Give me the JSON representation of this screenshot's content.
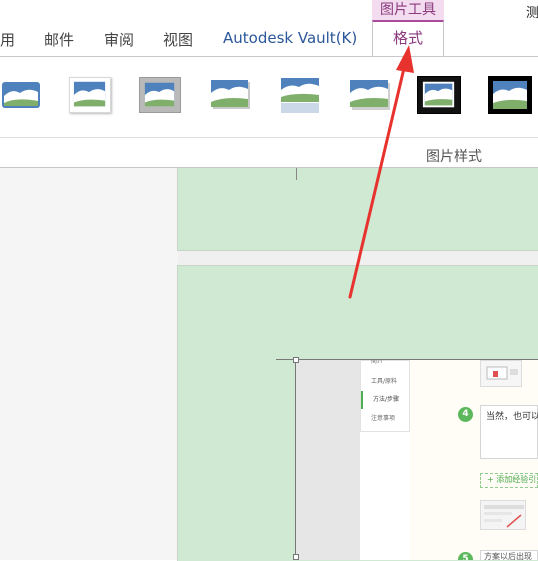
{
  "ribbon": {
    "tabs": [
      {
        "label": "用"
      },
      {
        "label": "邮件"
      },
      {
        "label": "审阅"
      },
      {
        "label": "视图"
      },
      {
        "label": "Autodesk Vault(K)"
      }
    ],
    "context_header": "图片工具",
    "active_tab": "格式",
    "corner_text": "测",
    "gallery_group_label": "图片样式",
    "picture_styles": [
      {
        "name": "soft-edge-style"
      },
      {
        "name": "white-frame-shadow-style"
      },
      {
        "name": "gray-bevel-frame-style"
      },
      {
        "name": "drop-shadow-style"
      },
      {
        "name": "reflection-style"
      },
      {
        "name": "perspective-shadow-style"
      },
      {
        "name": "black-thick-frame-style"
      },
      {
        "name": "black-frame-style"
      }
    ]
  },
  "document": {
    "picture": {
      "menu_items": [
        {
          "label": "简介"
        },
        {
          "label": "工具/原料"
        },
        {
          "label": "方法/步骤"
        },
        {
          "label": "注意事项"
        }
      ],
      "step4_number": "4",
      "step4_text": "当然，也可以",
      "add_line_text": "+ 添加经验引",
      "step5_number": "5",
      "step5_text": "方案以后出现"
    }
  },
  "colors": {
    "accent": "#a94d9a",
    "context_header_bg": "#f3dcef",
    "page_green": "#cfe9d2",
    "arrow": "#e8322e",
    "step_green": "#5cb85c"
  }
}
